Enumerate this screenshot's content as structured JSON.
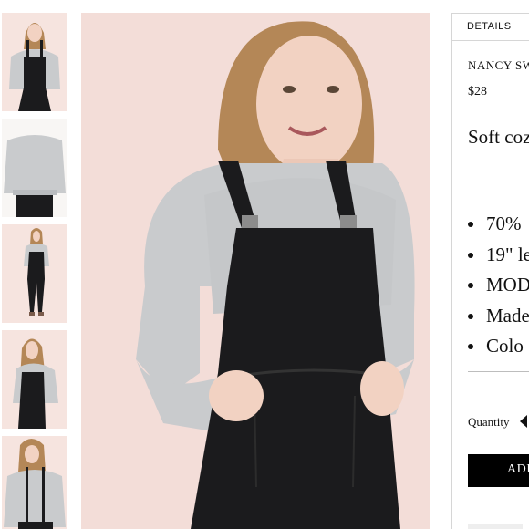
{
  "thumbnails": [
    {
      "label": "thumbnail-1"
    },
    {
      "label": "thumbnail-2"
    },
    {
      "label": "thumbnail-3"
    },
    {
      "label": "thumbnail-4"
    },
    {
      "label": "thumbnail-5"
    }
  ],
  "details": {
    "tab_label": "DETAILS",
    "product_name": "NANCY SW",
    "price": "$28",
    "description": "Soft coz grey.",
    "features": [
      "70%",
      "19\" le",
      "MOD",
      "Made",
      "Colo"
    ],
    "quantity_label": "Quantity",
    "add_button_label": "ADI"
  },
  "colors": {
    "backdrop": "#f3ddd8",
    "sweatshirt": "#c9cbcd",
    "overalls": "#1b1b1d",
    "hair": "#b48757",
    "skin": "#f2d2c2",
    "button": "#000000"
  }
}
